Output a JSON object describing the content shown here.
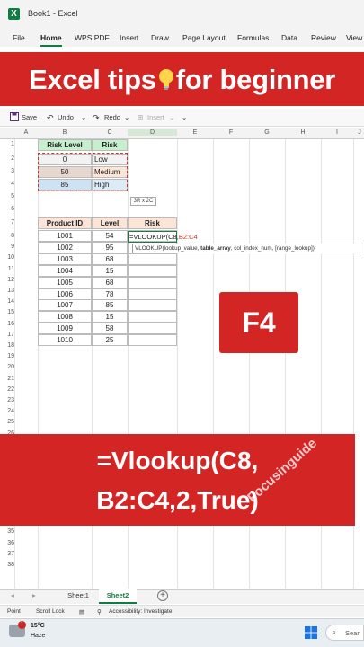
{
  "window": {
    "app_icon": "X",
    "title": "Book1  -  Excel"
  },
  "menu": [
    "File",
    "Home",
    "WPS PDF",
    "Insert",
    "Draw",
    "Page Layout",
    "Formulas",
    "Data",
    "Review",
    "View"
  ],
  "banner": {
    "before": "Excel tips",
    "after": "for beginner",
    "icon": "lightbulb-icon"
  },
  "qat": {
    "save": "Save",
    "undo": "Undo",
    "redo": "Redo",
    "insert": "Insert"
  },
  "columns": [
    "A",
    "B",
    "C",
    "D",
    "E",
    "F",
    "G",
    "H",
    "I",
    "J"
  ],
  "rows": [
    "1",
    "2",
    "3",
    "4",
    "5",
    "6",
    "7",
    "8",
    "9",
    "10",
    "11",
    "12",
    "13",
    "14",
    "15",
    "16",
    "17",
    "18",
    "19",
    "20",
    "21",
    "22",
    "23",
    "24",
    "25",
    "26",
    "27",
    "28",
    "29",
    "30",
    "31",
    "32",
    "33",
    "34",
    "35",
    "36",
    "37",
    "38"
  ],
  "lookup_table": {
    "headers": [
      "Risk Level",
      "Risk"
    ],
    "rows": [
      [
        "0",
        "Low"
      ],
      [
        "50",
        "Medium"
      ],
      [
        "85",
        "High"
      ]
    ]
  },
  "copy_size_tip": "3R x 2C",
  "product_table": {
    "headers": [
      "Product ID",
      "Level",
      "Risk"
    ],
    "rows": [
      [
        "1001",
        "54"
      ],
      [
        "1002",
        "95"
      ],
      [
        "1003",
        "68"
      ],
      [
        "1004",
        "15"
      ],
      [
        "1005",
        "68"
      ],
      [
        "1006",
        "78"
      ],
      [
        "1007",
        "85"
      ],
      [
        "1008",
        "15"
      ],
      [
        "1009",
        "58"
      ],
      [
        "1010",
        "25"
      ]
    ]
  },
  "formula_cell": {
    "prefix": "=VLOOKUP(C8,",
    "ref": "B2:C4"
  },
  "tooltip": {
    "fn": "VLOOKUP(",
    "a1": "lookup_value, ",
    "a2": "table_array",
    "a3": ", col_index_num, [range_lookup])"
  },
  "key_hint": "F4",
  "formula_banner": {
    "line1": "=Vlookup(C8,",
    "line2": "B2:C4,2,True)"
  },
  "watermark": "Focusinguide",
  "sheets": [
    "Sheet1",
    "Sheet2"
  ],
  "active_sheet": "Sheet2",
  "status": {
    "mode": "Point",
    "scroll_lock": "Scroll Lock",
    "accessibility": "Accessibility: Investigate"
  },
  "taskbar": {
    "temp": "15°C",
    "weather": "Haze",
    "badge": "1",
    "search": "Sear"
  },
  "colors": {
    "brand_red": "#d42525",
    "excel_green": "#107c41",
    "header_green": "#c6efce",
    "header_peach": "#fce4d6"
  }
}
